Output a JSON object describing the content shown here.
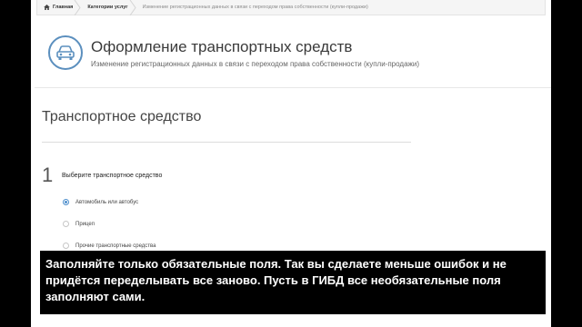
{
  "breadcrumb": {
    "home": "Главная",
    "categories": "Категории услуг",
    "current": "Изменение регистрационных данных в связи с переходом права собственности (купли-продажи)"
  },
  "header": {
    "title": "Оформление транспортных средств",
    "subtitle": "Изменение регистрационных данных в связи с переходом права собственности (купли-продажи)"
  },
  "section": {
    "title": "Транспортное средство"
  },
  "step": {
    "number": "1",
    "question": "Выберите транспортное средство",
    "options": [
      {
        "label": "Автомобиль или автобус",
        "checked": true
      },
      {
        "label": "Прицеп",
        "checked": false
      },
      {
        "label": "Прочие транспортные средства",
        "checked": false
      }
    ]
  },
  "caption": {
    "text": "Заполняйте только обязательные поля. Так вы сделаете меньше ошибок и не придётся переделывать все заново. Пусть в ГИБД все необязательные поля заполняют сами."
  },
  "colors": {
    "accent": "#4d8ecc",
    "icon_blue": "#5b8fbe"
  }
}
